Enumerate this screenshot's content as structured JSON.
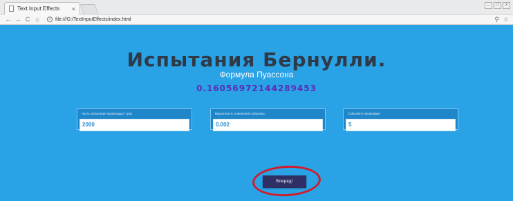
{
  "browser": {
    "tab_title": "Text Input Effects",
    "tab_close": "×",
    "url": "file:///G:/TextInputEffects/index.html",
    "nav": {
      "back": "←",
      "forward": "→",
      "reload": "C",
      "home": "⌂"
    },
    "info_icon": "i",
    "addr_icons": {
      "zoom": "⚲",
      "star": "☆"
    },
    "window_controls": [
      "–",
      "□",
      "×"
    ]
  },
  "page": {
    "title": "Испытания Бернулли.",
    "subtitle": "Формула Пуассона",
    "result": "0.16056972144289453"
  },
  "fields": [
    {
      "label": "Пусть испытание происходит n раз",
      "value": "2000"
    },
    {
      "label": "Вероятность появления события p",
      "value": "0.002"
    },
    {
      "label": "Событие k произойдет",
      "value": "5"
    }
  ],
  "actions": {
    "go_label": "Вперед!"
  },
  "colors": {
    "background": "#2aa3e6",
    "title": "#2f3a48",
    "result": "#5b2bb8",
    "button": "#2f2f66",
    "annotation_circle": "#d11c2a"
  }
}
